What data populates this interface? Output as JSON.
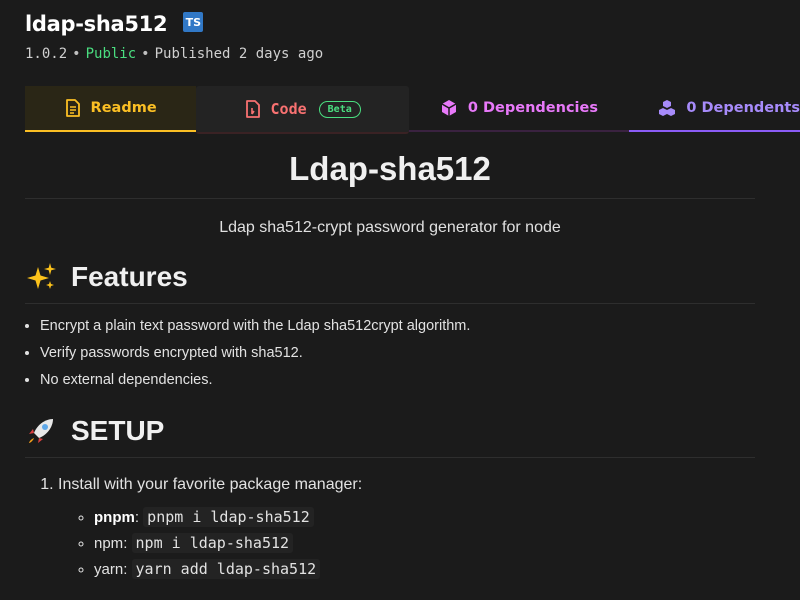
{
  "package": {
    "name": "ldap-sha512",
    "ts_badge": "TS",
    "version": "1.0.2",
    "separator": "•",
    "visibility": "Public",
    "published": "Published 2 days ago"
  },
  "tabs": [
    {
      "label": "Readme",
      "icon": "readme-icon"
    },
    {
      "label": "Code",
      "icon": "code-file-icon",
      "badge": "Beta"
    },
    {
      "label": "0 Dependencies",
      "icon": "box-icon"
    },
    {
      "label": "0 Dependents",
      "icon": "boxes-icon"
    }
  ],
  "readme": {
    "title": "Ldap-sha512",
    "description": "Ldap sha512-crypt password generator for node",
    "features_heading": "Features",
    "features": [
      "Encrypt a plain text password with the Ldap sha512crypt algorithm.",
      "Verify passwords encrypted with sha512.",
      "No external dependencies."
    ],
    "setup_heading": "SETUP",
    "steps": [
      "Install with your favorite package manager:"
    ],
    "package_managers": [
      {
        "name": "pnpm",
        "sep": ":",
        "command": "pnpm i ldap-sha512"
      },
      {
        "name": "npm",
        "sep": ":",
        "command": "npm i ldap-sha512"
      },
      {
        "name": "yarn",
        "sep": ":",
        "command": "yarn add ldap-sha512"
      }
    ]
  },
  "colors": {
    "background": "#1b1b1b",
    "readme_accent": "#fbbf24",
    "code_accent": "#f87171",
    "dependencies_accent": "#e879f9",
    "dependents_accent": "#a78bfa",
    "public": "#4ade80",
    "ts_badge": "#3178c6"
  }
}
